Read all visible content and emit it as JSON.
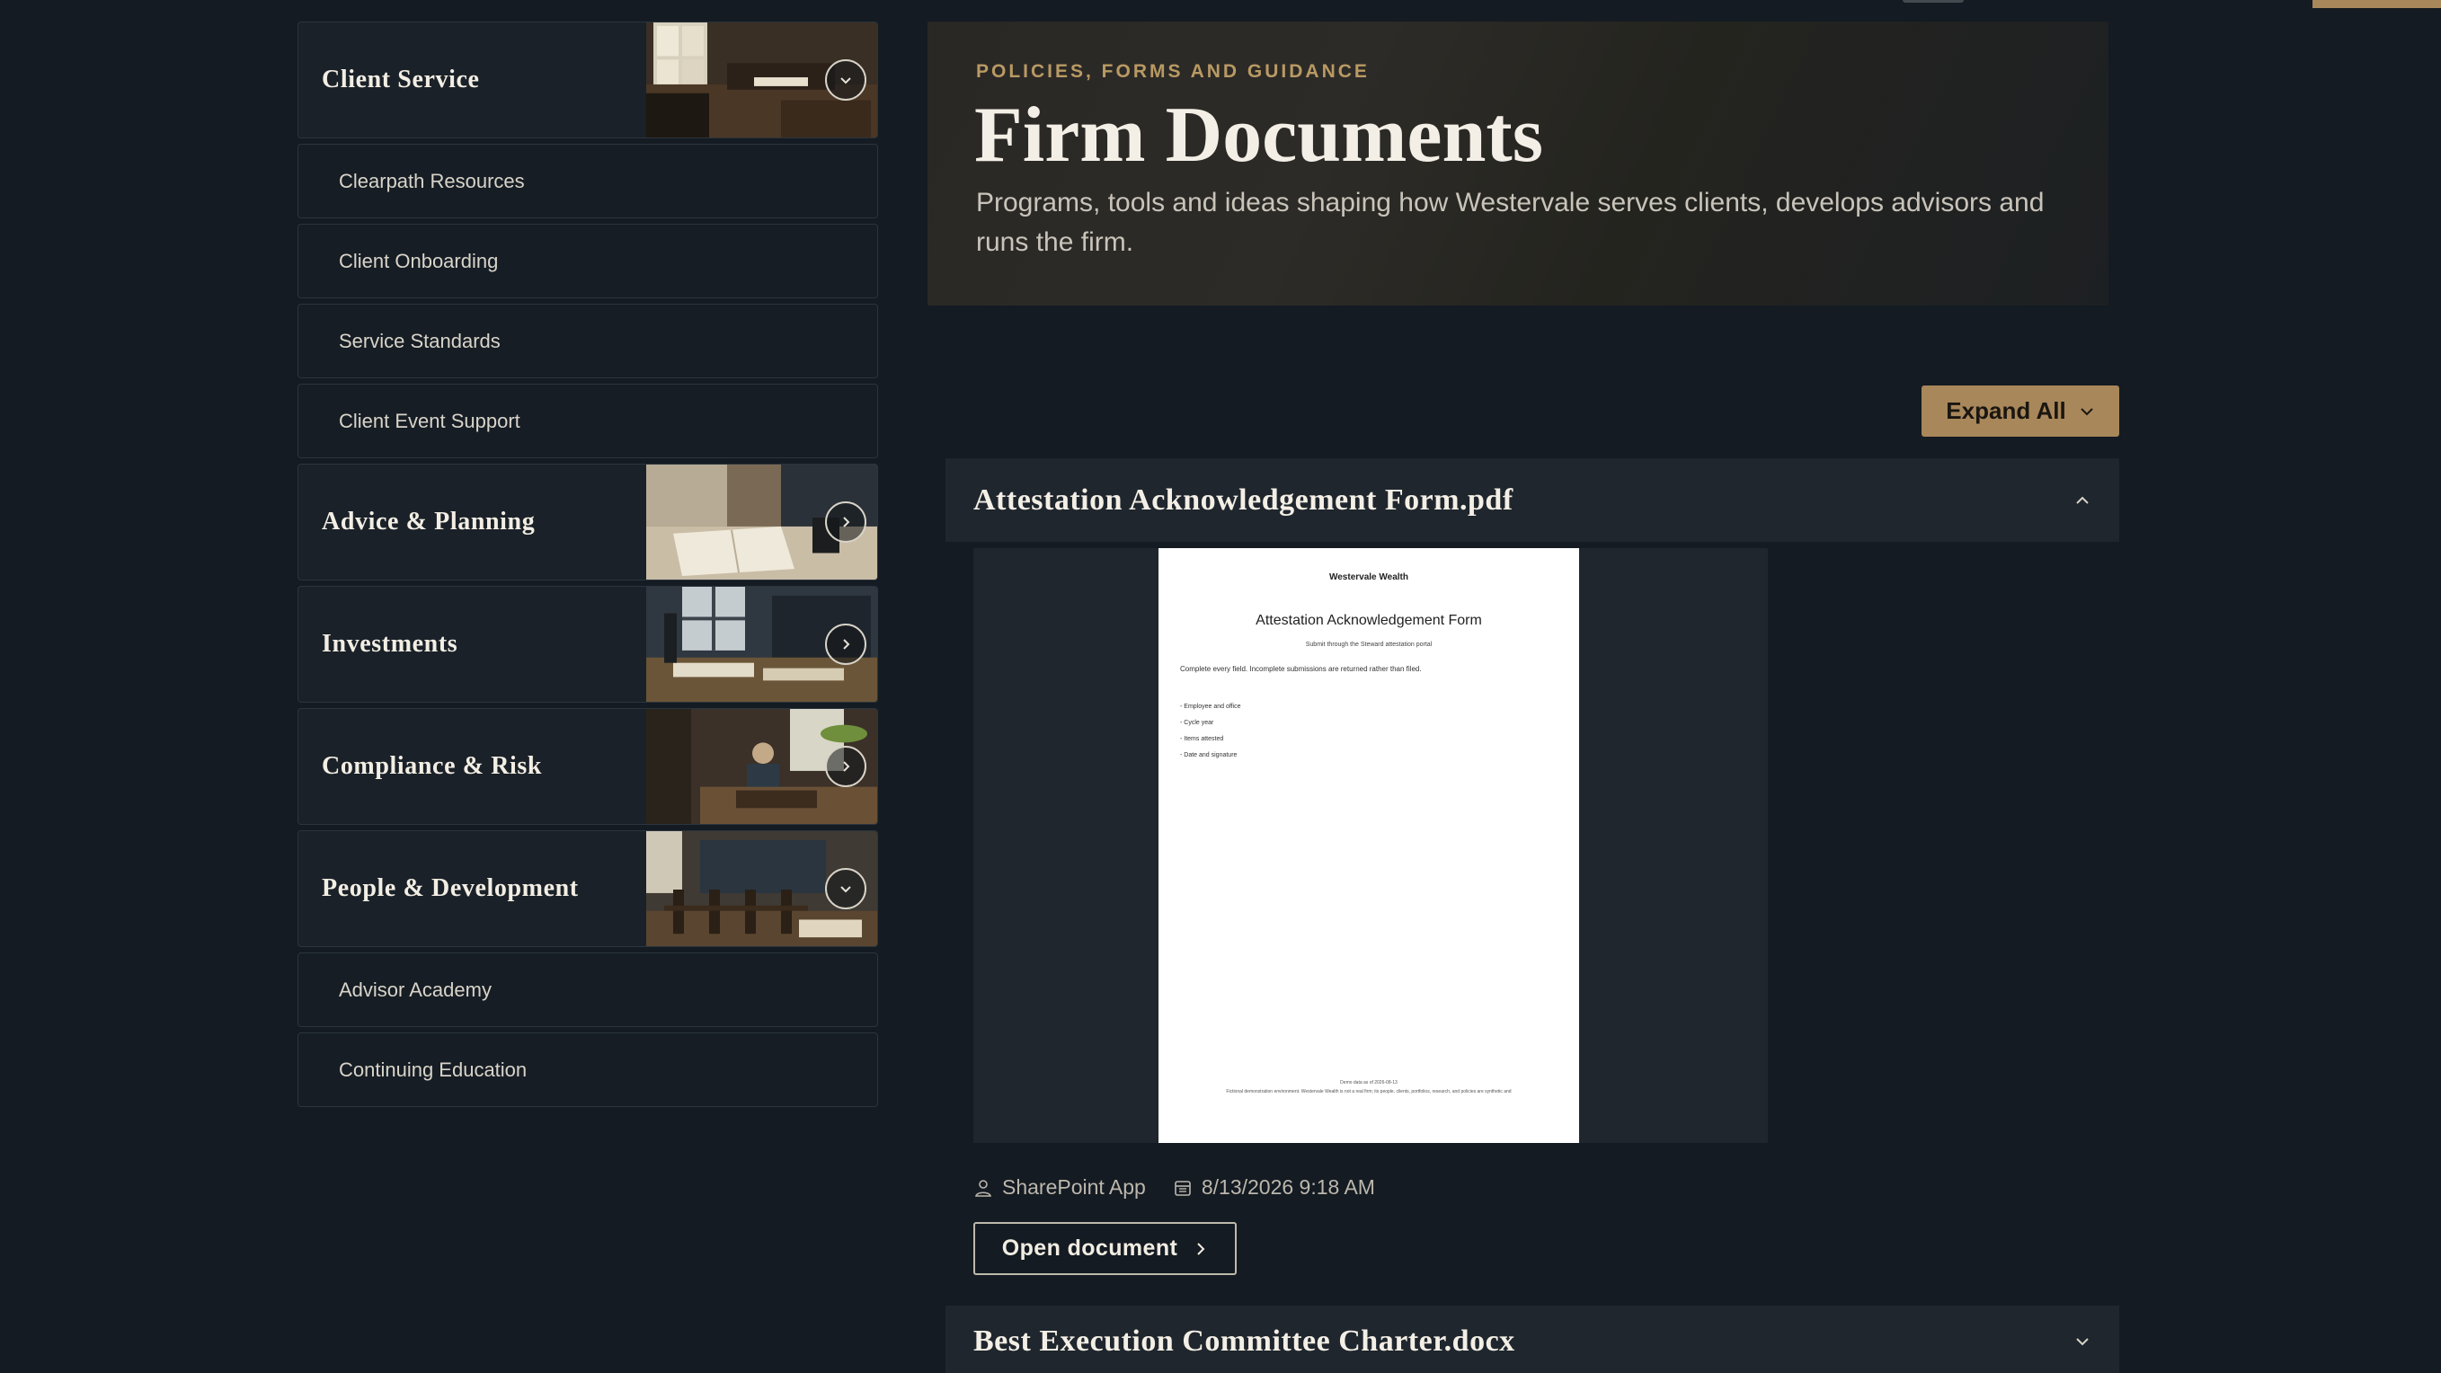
{
  "sidebar": {
    "categories": [
      {
        "label": "Client Service",
        "state": "expanded",
        "icon": "chevron-down-icon",
        "children": [
          "Clearpath Resources",
          "Client Onboarding",
          "Service Standards",
          "Client Event Support"
        ]
      },
      {
        "label": "Advice & Planning",
        "state": "collapsed",
        "icon": "chevron-right-icon"
      },
      {
        "label": "Investments",
        "state": "collapsed",
        "icon": "chevron-right-icon"
      },
      {
        "label": "Compliance & Risk",
        "state": "collapsed",
        "icon": "chevron-right-icon"
      },
      {
        "label": "People & Development",
        "state": "expanded",
        "icon": "chevron-down-icon",
        "children": [
          "Advisor Academy",
          "Continuing Education"
        ]
      }
    ]
  },
  "hero": {
    "eyebrow": "POLICIES, FORMS AND GUIDANCE",
    "title": "Firm Documents",
    "description": "Programs, tools and ideas shaping how Westervale serves clients, develops advisors and runs the firm."
  },
  "toolbar": {
    "expand_all_label": "Expand All",
    "expand_all_icon": "chevron-down-icon"
  },
  "documents": [
    {
      "title": "Attestation Acknowledgement Form.pdf",
      "state": "expanded",
      "toggle_icon": "chevron-up-icon",
      "preview": {
        "brand": "Westervale Wealth",
        "title": "Attestation Acknowledgement Form",
        "subtitle": "Submit through the Steward attestation portal",
        "intro": "Complete every field. Incomplete submissions are returned rather than filed.",
        "list": [
          "- Employee and office",
          "- Cycle year",
          "- Items attested",
          "- Date and signature"
        ],
        "footer_line1": "Demo data as of 2026-08-13",
        "footer_line2": "Fictional demonstration environment. Westervale Wealth is not a real firm; its people, clients, portfolios, research, and policies are synthetic and"
      },
      "meta": {
        "author_icon": "user-icon",
        "author": "SharePoint App",
        "date_icon": "calendar-icon",
        "modified": "8/13/2026 9:18 AM"
      },
      "open_label": "Open document"
    },
    {
      "title": "Best Execution Committee Charter.docx",
      "state": "collapsed",
      "toggle_icon": "chevron-down-icon"
    }
  ],
  "colors": {
    "background": "#141b22",
    "accent": "#a8875a",
    "eyebrow": "#b99a64",
    "panel": "#1f262d"
  }
}
